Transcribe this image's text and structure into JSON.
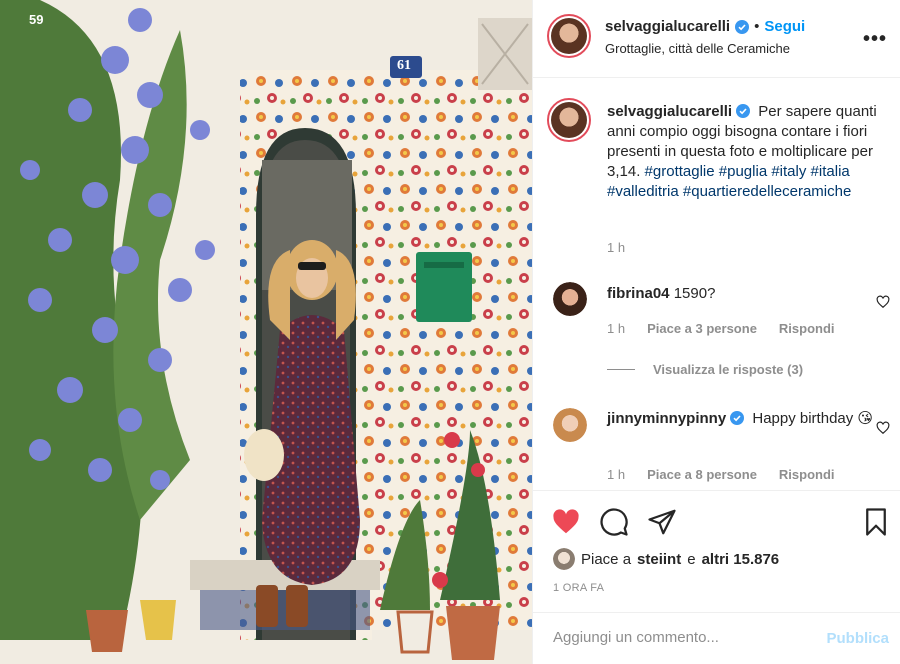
{
  "post": {
    "author": "selvaggialucarelli",
    "follow_label": "Segui",
    "location": "Grottaglie, città delle Ceramiche",
    "more_label": "•••",
    "photo": {
      "house_number_left": "59",
      "house_number_right": "61"
    }
  },
  "caption": {
    "author": "selvaggialucarelli",
    "text": "Per sapere quanti anni compio oggi bisogna contare i fiori presenti in questa foto e moltiplicare per 3,14.",
    "hashtags": [
      "#grottaglie",
      "#puglia",
      "#italy",
      "#italia",
      "#valleditria",
      "#quartieredelleceramiche"
    ],
    "time": "1 h"
  },
  "comments": [
    {
      "user": "fibrina04",
      "text": "1590?",
      "time": "1 h",
      "likes": "Piace a 3 persone",
      "reply": "Rispondi"
    },
    {
      "user": "jinnyminnypinny",
      "text": "Happy birthday 😘",
      "time": "1 h",
      "likes": "Piace a 8 persone",
      "reply": "Rispondi"
    }
  ],
  "view_replies": "Visualizza le risposte (3)",
  "likes": {
    "prefix": "Piace a",
    "user": "steiint",
    "joiner": "e",
    "others": "altri 15.876"
  },
  "posted_ago": "1 ORA FA",
  "comment_input": {
    "placeholder": "Aggiungi un commento...",
    "submit": "Pubblica"
  },
  "colors": {
    "accent": "#0095f6",
    "like_red": "#ed4956",
    "hashtag": "#00376b",
    "muted": "#8e8e8e"
  },
  "icons": [
    "verified-badge-icon",
    "more-options-icon",
    "heart-filled-icon",
    "comment-icon",
    "share-icon",
    "bookmark-icon",
    "heart-outline-icon"
  ]
}
